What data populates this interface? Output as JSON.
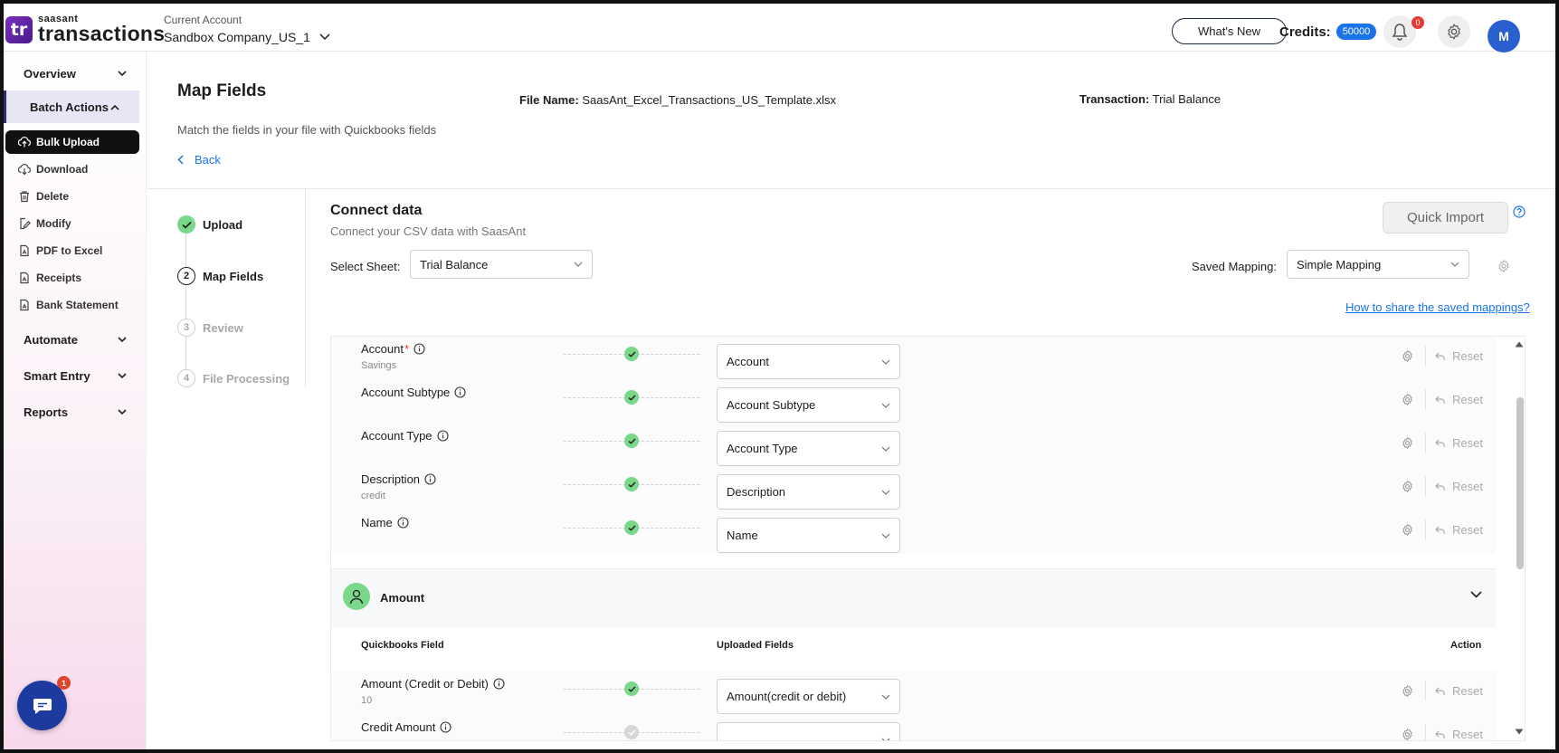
{
  "app": {
    "logo_mark": "tr",
    "logo_small": "saasant",
    "logo_big": "transactions"
  },
  "header": {
    "account_label": "Current Account",
    "account_name": "Sandbox Company_US_1",
    "whats_new": "What's New",
    "credits_label": "Credits:",
    "credits_value": "50000",
    "notifications_count": "0",
    "avatar_initial": "M"
  },
  "sidebar": {
    "sections": [
      {
        "label": "Overview"
      },
      {
        "label": "Batch Actions"
      },
      {
        "label": "Automate"
      },
      {
        "label": "Smart Entry"
      },
      {
        "label": "Reports"
      }
    ],
    "items": [
      {
        "label": "Bulk Upload",
        "icon": "upload-icon"
      },
      {
        "label": "Download",
        "icon": "download-icon"
      },
      {
        "label": "Delete",
        "icon": "trash-icon"
      },
      {
        "label": "Modify",
        "icon": "edit-icon"
      },
      {
        "label": "PDF to Excel",
        "icon": "pdf-icon"
      },
      {
        "label": "Receipts",
        "icon": "receipt-icon"
      },
      {
        "label": "Bank Statement",
        "icon": "bank-statement-icon"
      }
    ],
    "chat_badge": "1"
  },
  "page": {
    "title": "Map Fields",
    "subtitle": "Match the fields in your file with Quickbooks fields",
    "back": "Back",
    "file_name_label": "File Name:",
    "file_name": "SaasAnt_Excel_Transactions_US_Template.xlsx",
    "transaction_label": "Transaction:",
    "transaction": "Trial Balance"
  },
  "steps": [
    {
      "num": "1",
      "label": "Upload",
      "state": "done"
    },
    {
      "num": "2",
      "label": "Map Fields",
      "state": "current"
    },
    {
      "num": "3",
      "label": "Review",
      "state": "pending"
    },
    {
      "num": "4",
      "label": "File Processing",
      "state": "pending"
    }
  ],
  "connect": {
    "title": "Connect data",
    "subtitle": "Connect your CSV data with SaasAnt",
    "quick_import": "Quick Import",
    "select_sheet_label": "Select Sheet:",
    "select_sheet_value": "Trial Balance",
    "saved_mapping_label": "Saved Mapping:",
    "saved_mapping_value": "Simple Mapping",
    "share_link": "How to share the saved mappings?"
  },
  "mapping": {
    "reset_label": "Reset",
    "rows": [
      {
        "field": "Account",
        "required": "*",
        "sample": "Savings",
        "mapped": "Account"
      },
      {
        "field": "Account Subtype",
        "required": "",
        "sample": "",
        "mapped": "Account Subtype"
      },
      {
        "field": "Account Type",
        "required": "",
        "sample": "",
        "mapped": "Account Type"
      },
      {
        "field": "Description",
        "required": "",
        "sample": "credit",
        "mapped": "Description"
      },
      {
        "field": "Name",
        "required": "",
        "sample": "",
        "mapped": "Name"
      }
    ],
    "amount_section": {
      "title": "Amount",
      "col_qb": "Quickbooks Field",
      "col_uploaded": "Uploaded Fields",
      "col_action": "Action",
      "rows": [
        {
          "field": "Amount (Credit or Debit)",
          "sample": "10",
          "mapped": "Amount(credit or debit)"
        },
        {
          "field": "Credit Amount",
          "sample": "",
          "mapped": ""
        }
      ]
    }
  }
}
